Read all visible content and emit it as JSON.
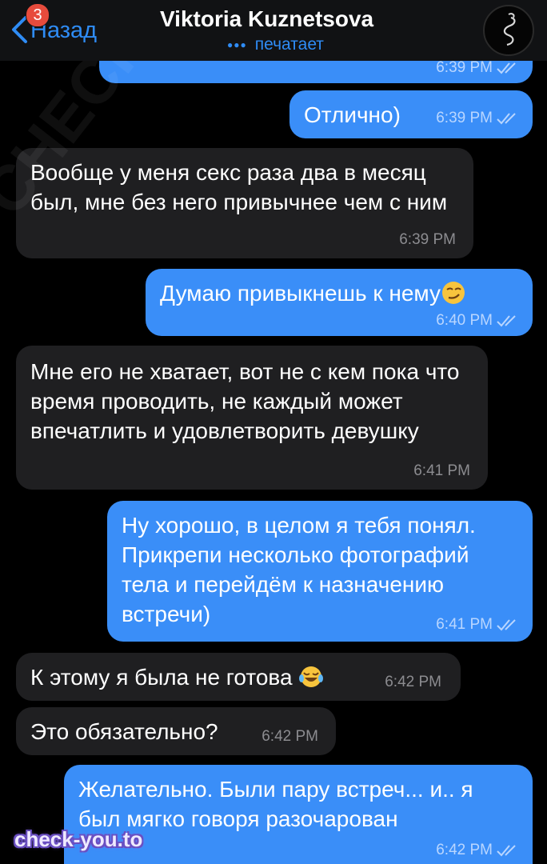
{
  "header": {
    "back_label": "Назад",
    "unread_count": "3",
    "contact_name": "Viktoria Kuznetsova",
    "status": "печатает"
  },
  "messages": [
    {
      "side": "out",
      "text": "",
      "time": "6:39 PM"
    },
    {
      "side": "out",
      "text": "Отлично)",
      "time": "6:39 PM"
    },
    {
      "side": "in",
      "text": "Вообще у меня секс раза два в месяц был, мне без него привычнее чем с ним",
      "time": "6:39 PM"
    },
    {
      "side": "out",
      "text": "Думаю привыкнешь к нему",
      "emoji": "smirking-face",
      "time": "6:40 PM"
    },
    {
      "side": "in",
      "text": "Мне его не хватает, вот не с кем пока что время проводить, не каждый может впечатлить и удовлетворить девушку",
      "time": "6:41 PM"
    },
    {
      "side": "out",
      "text": "Ну хорошо, в целом я тебя понял. Прикрепи несколько фотографий тела и перейдём к назначению встречи)",
      "time": "6:41 PM"
    },
    {
      "side": "in",
      "text": "К этому я была не готова",
      "emoji": "tears-of-joy",
      "time": "6:42 PM"
    },
    {
      "side": "in",
      "text": "Это обязательно?",
      "time": "6:42 PM"
    },
    {
      "side": "out",
      "text": "Желательно. Были пару встреч... и.. я был мягко говоря разочарован",
      "time": "6:42 PM"
    }
  ],
  "watermark": "check-you.to",
  "background_watermark": "CHECK-YOU.ME",
  "colors": {
    "outgoing_bubble": "#3a8ef8",
    "incoming_bubble": "#1f1f21",
    "accent": "#2f8cf5",
    "background": "#000000"
  }
}
